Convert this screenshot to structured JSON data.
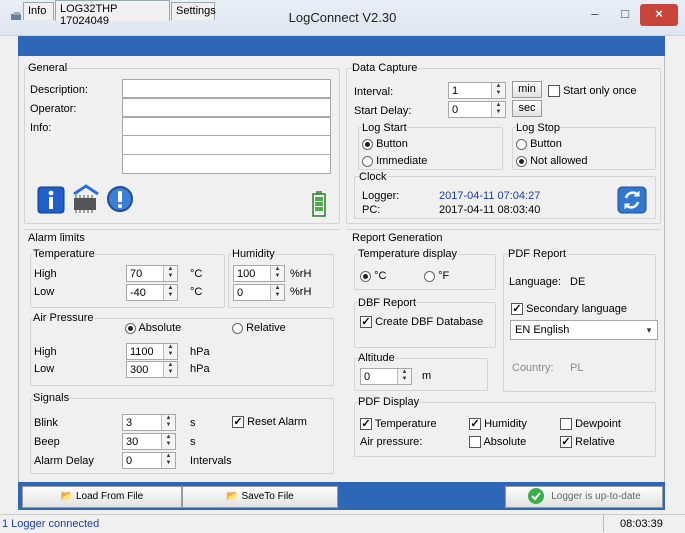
{
  "window": {
    "title": "LogConnect V2.30",
    "minimize": "–",
    "maximize": "□",
    "close": "×"
  },
  "tabs": [
    "Info",
    "LOG32THP 17024049",
    "Settings"
  ],
  "general": {
    "group": "General",
    "description": "Description:",
    "operator": "Operator:",
    "info": "Info:"
  },
  "alarm": {
    "group": "Alarm limits",
    "temperature": "Temperature",
    "humidity": "Humidity",
    "high": "High",
    "low": "Low",
    "temp_high": "70",
    "temp_low": "-40",
    "temp_unit": "°C",
    "hum_high": "100",
    "hum_low": "0",
    "hum_unit": "%rH",
    "air_pressure": "Air Pressure",
    "absolute": "Absolute",
    "relative": "Relative",
    "p_high": "1100",
    "p_low": "300",
    "p_unit": "hPa"
  },
  "signals": {
    "group": "Signals",
    "blink": "Blink",
    "blink_val": "3",
    "blink_unit": "s",
    "beep": "Beep",
    "beep_val": "30",
    "beep_unit": "s",
    "delay": "Alarm Delay",
    "delay_val": "0",
    "delay_unit": "Intervals",
    "reset": "Reset Alarm"
  },
  "capture": {
    "group": "Data Capture",
    "interval": "Interval:",
    "interval_val": "1",
    "start_delay": "Start Delay:",
    "start_delay_val": "0",
    "min": "min",
    "sec": "sec",
    "start_once": "Start only once",
    "log_start": "Log Start",
    "button": "Button",
    "immediate": "Immediate",
    "log_stop": "Log Stop",
    "stop_button": "Button",
    "not_allowed": "Not allowed"
  },
  "clock": {
    "group": "Clock",
    "logger": "Logger:",
    "logger_time": "2017-04-11 07:04:27",
    "pc": "PC:",
    "pc_time": "2017-04-11 08:03:40"
  },
  "report": {
    "group": "Report Generation",
    "temp_display": "Temperature display",
    "c": "°C",
    "f": "°F",
    "dbf": "DBF Report",
    "create_dbf": "Create DBF Database",
    "altitude": "Altitude",
    "altitude_val": "0",
    "altitude_unit": "m",
    "pdf": "PDF Report",
    "language": "Language:",
    "language_val": "DE",
    "secondary": "Secondary language",
    "secondary_val": "EN English",
    "country": "Country:",
    "country_val": "PL"
  },
  "pdf_display": {
    "group": "PDF Display",
    "temperature": "Temperature",
    "humidity": "Humidity",
    "dewpoint": "Dewpoint",
    "air_pressure": "Air pressure:",
    "absolute": "Absolute",
    "relative": "Relative"
  },
  "bottom": {
    "load": "Load From File",
    "save": "SaveTo File",
    "status": "Logger is up-to-date"
  },
  "status": {
    "left": "1 Logger connected",
    "time": "08:03:39"
  },
  "colors": {
    "accent": "#2e66b8",
    "value_text": "#1a3ba8",
    "close": "#c9453c",
    "battery": "#4cb04c"
  }
}
